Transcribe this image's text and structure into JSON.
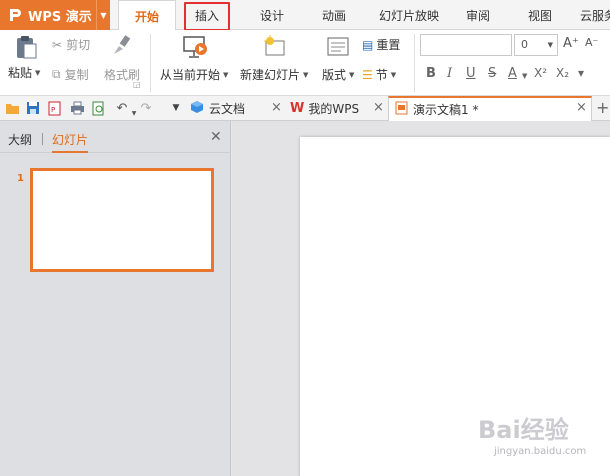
{
  "app": {
    "title": "WPS 演示"
  },
  "menu_tabs": [
    {
      "label": "开始",
      "active": true
    },
    {
      "label": "插入",
      "active": false,
      "highlighted": true
    },
    {
      "label": "设计",
      "active": false
    },
    {
      "label": "动画",
      "active": false
    },
    {
      "label": "幻灯片放映",
      "active": false
    },
    {
      "label": "审阅",
      "active": false
    },
    {
      "label": "视图",
      "active": false
    },
    {
      "label": "云服务",
      "active": false
    }
  ],
  "ribbon": {
    "paste": "粘贴",
    "cut": "剪切",
    "copy": "复制",
    "format_painter": "格式刷",
    "play_from_current": "从当前开始",
    "new_slide": "新建幻灯片",
    "layout": "版式",
    "reset": "重置",
    "section": "节",
    "font_name": "",
    "font_size": "0",
    "grow_font": "A⁺",
    "shrink_font": "A⁻",
    "bold": "B",
    "italic": "I",
    "underline": "U",
    "strike": "S",
    "font_color": "A",
    "superscript": "X²",
    "subscript": "X₂"
  },
  "doc_tabs": [
    {
      "label": "云文档",
      "icon": "cube-icon"
    },
    {
      "label": "我的WPS",
      "icon": "wps-logo-icon"
    },
    {
      "label": "演示文稿1 *",
      "icon": "presentation-file-icon",
      "active": true
    }
  ],
  "left_panel": {
    "tab_outline": "大纲",
    "tab_slides": "幻灯片",
    "slides": [
      {
        "number": "1"
      }
    ]
  },
  "watermark": {
    "main": "Bai经验",
    "sub": "jingyan.baidu.com"
  },
  "colors": {
    "accent": "#e8762d",
    "highlight": "#e23030"
  }
}
